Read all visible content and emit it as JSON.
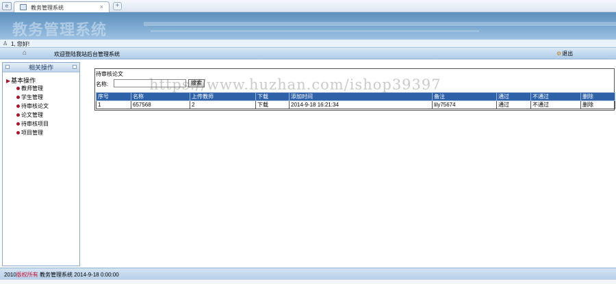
{
  "browser": {
    "tab_title": "教务管理系统",
    "tab_close": "×",
    "new_tab": "+"
  },
  "banner": {
    "title": "教务管理系统"
  },
  "user": {
    "greeting": "1, 您好!"
  },
  "nav": {
    "welcome": "欢迎登陆我站后台管理系统",
    "logout": "退出"
  },
  "sidebar": {
    "header": "相关操作",
    "root": "基本操作",
    "items": [
      {
        "label": "教师管理"
      },
      {
        "label": "学生管理"
      },
      {
        "label": "待审核论文"
      },
      {
        "label": "论文管理"
      },
      {
        "label": "待审核项目"
      },
      {
        "label": "项目管理"
      }
    ]
  },
  "main": {
    "title": "待审核论文",
    "search_label": "名称:",
    "search_value": "",
    "search_button": "搜索",
    "columns": [
      "序号",
      "名称",
      "上传教师",
      "下载",
      "添加时间",
      "备注",
      "通过",
      "不通过",
      "删除"
    ],
    "rows": [
      [
        "1",
        "657568",
        "2",
        "下载",
        "2014-9-18 16:21:34",
        "lily75674",
        "通过",
        "不通过",
        "删除"
      ]
    ]
  },
  "watermark": "https://www.huzhan.com/ishop39397",
  "footer": {
    "copyright_prefix": "2010",
    "copyright_red": "版权所有",
    "system": "教务管理系统 2014-9-18 0:00:00"
  },
  "colors": {
    "banner": "#7eaad2",
    "table_header": "#2d61a8",
    "accent_red": "#b0142a"
  }
}
